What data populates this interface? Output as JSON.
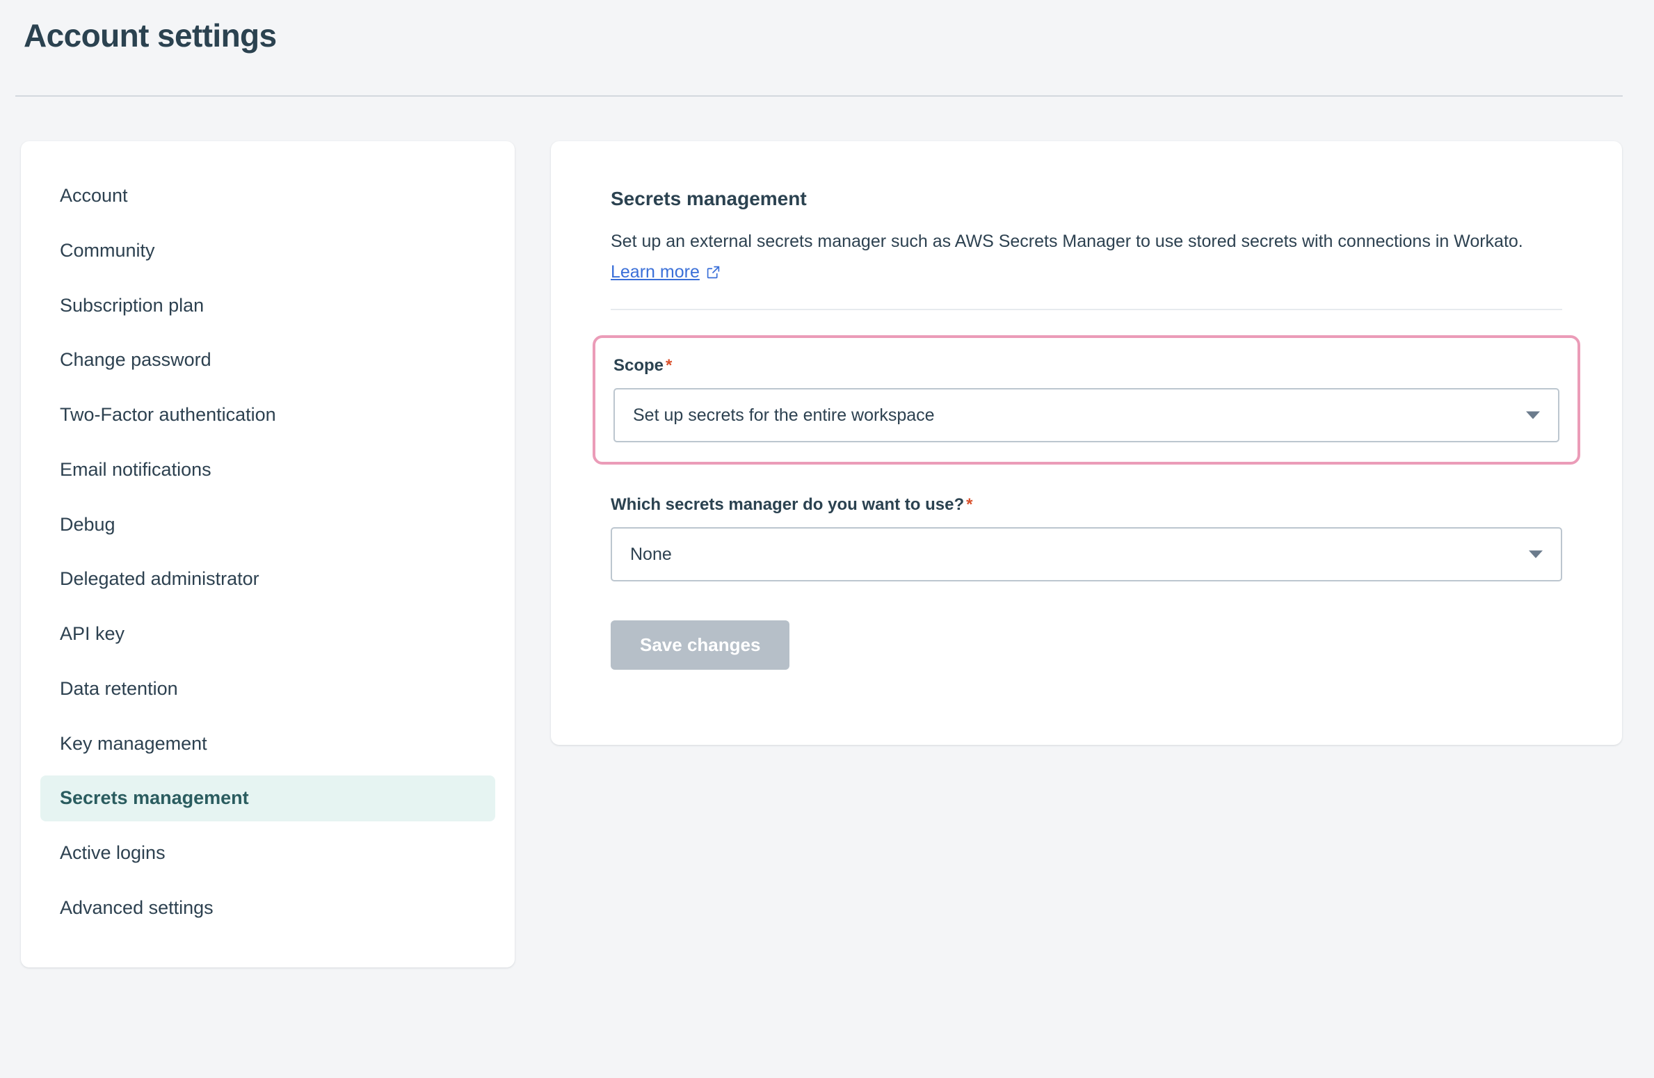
{
  "header": {
    "title": "Account settings"
  },
  "sidebar": {
    "items": [
      {
        "label": "Account",
        "active": false
      },
      {
        "label": "Community",
        "active": false
      },
      {
        "label": "Subscription plan",
        "active": false
      },
      {
        "label": "Change password",
        "active": false
      },
      {
        "label": "Two-Factor authentication",
        "active": false
      },
      {
        "label": "Email notifications",
        "active": false
      },
      {
        "label": "Debug",
        "active": false
      },
      {
        "label": "Delegated administrator",
        "active": false
      },
      {
        "label": "API key",
        "active": false
      },
      {
        "label": "Data retention",
        "active": false
      },
      {
        "label": "Key management",
        "active": false
      },
      {
        "label": "Secrets management",
        "active": true
      },
      {
        "label": "Active logins",
        "active": false
      },
      {
        "label": "Advanced settings",
        "active": false
      }
    ]
  },
  "main": {
    "section_title": "Secrets management",
    "section_description": "Set up an external secrets manager such as AWS Secrets Manager to use stored secrets with connections in Workato.",
    "learn_more_label": "Learn more",
    "learn_more_icon": "external-link-icon",
    "scope_field": {
      "label": "Scope",
      "required_marker": "*",
      "selected_value": "Set up secrets for the entire workspace",
      "caret_icon": "chevron-down-icon",
      "highlighted": true
    },
    "manager_field": {
      "label": "Which secrets manager do you want to use?",
      "required_marker": "*",
      "selected_value": "None",
      "caret_icon": "chevron-down-icon"
    },
    "save_button_label": "Save changes"
  },
  "colors": {
    "page_background": "#f4f5f7",
    "card_background": "#ffffff",
    "text_primary": "#2d4150",
    "link": "#3a6fd8",
    "highlight_border": "#eb9cb8",
    "active_nav_background": "#e6f4f2",
    "active_nav_text": "#2a5c5f",
    "required_star": "#d9512c",
    "save_button_disabled": "#b6bfc8"
  }
}
